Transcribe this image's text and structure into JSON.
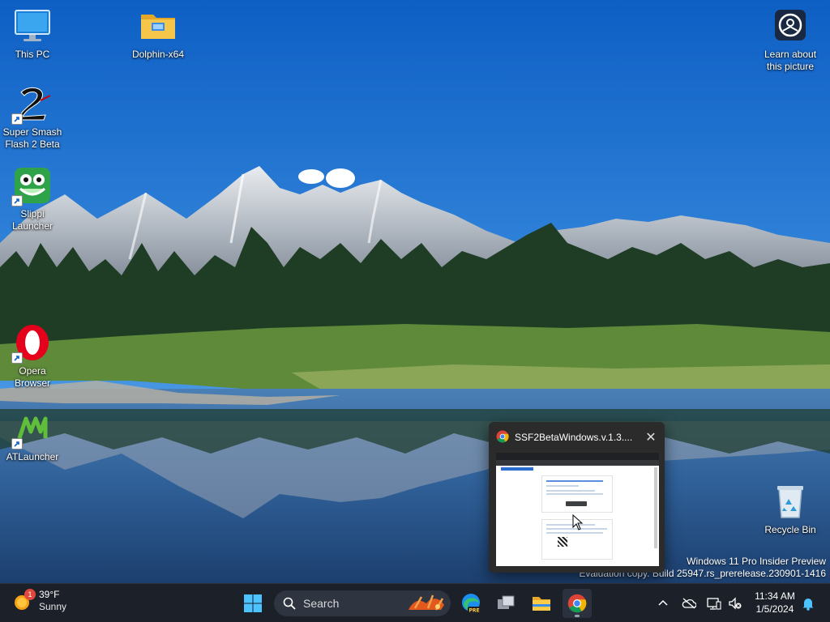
{
  "desktop": {
    "icons": [
      {
        "label": "This PC",
        "icon": "monitor-icon"
      },
      {
        "label": "Dolphin-x64",
        "icon": "folder-icon"
      },
      {
        "label": "Super Smash Flash 2 Beta",
        "icon": "ssf2-icon"
      },
      {
        "label": "Slippi Launcher",
        "icon": "slippi-frog-icon"
      },
      {
        "label": "Opera Browser",
        "icon": "opera-icon"
      },
      {
        "label": "ATLauncher",
        "icon": "atlauncher-icon"
      },
      {
        "label": "Recycle Bin",
        "icon": "recycle-bin-icon"
      },
      {
        "label": "Learn about this picture",
        "icon": "camera-spotlight-icon"
      }
    ],
    "watermark": {
      "line1": "Windows 11 Pro Insider Preview",
      "line2": "Evaluation copy. Build 25947.rs_prerelease.230901-1416"
    }
  },
  "preview": {
    "title": "SSF2BetaWindows.v.1.3....",
    "close_icon": "close-icon"
  },
  "taskbar": {
    "weather": {
      "badge": "1",
      "temp": "39°F",
      "condition": "Sunny"
    },
    "search_placeholder": "Search",
    "apps": [
      "windows-start-icon",
      "search-icon",
      "edge-pre-icon",
      "task-view-icon",
      "file-explorer-icon",
      "chrome-icon"
    ],
    "tray": [
      "chevron-up-icon",
      "onedrive-offline-icon",
      "network-icon",
      "volume-muted-icon",
      "notifications-bell-icon"
    ],
    "clock": {
      "time": "11:34 AM",
      "date": "1/5/2024"
    }
  },
  "colors": {
    "taskbar": "#1c2029",
    "accent": "#0078d4",
    "sky": "#1e6fc9"
  }
}
